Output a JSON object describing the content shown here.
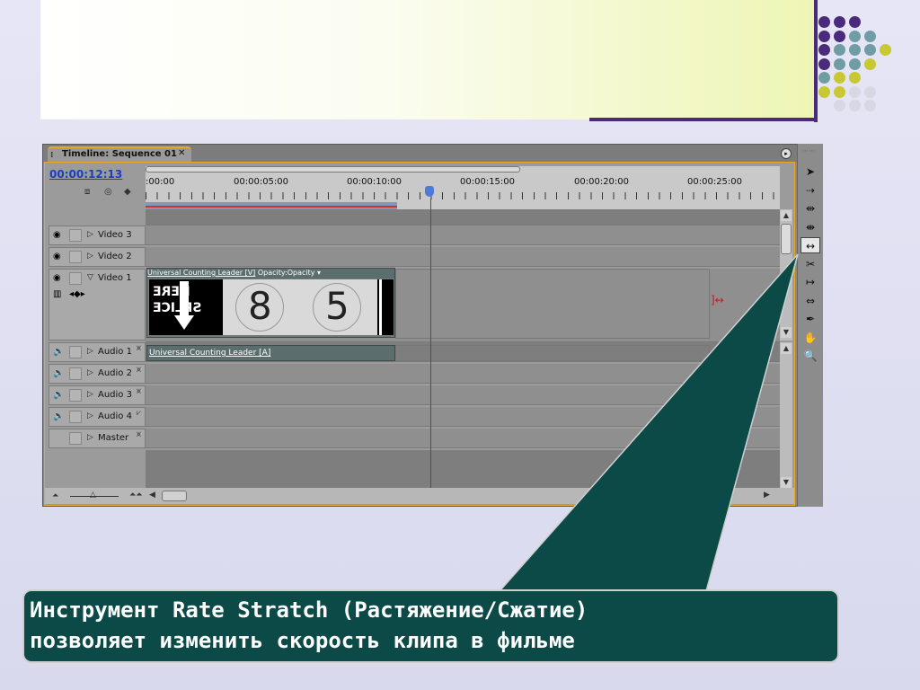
{
  "timeline": {
    "tab_title": "Timeline: Sequence 01",
    "tab_close": "✕",
    "menu_icon": "▸",
    "timecode": "00:00:12:13",
    "ruler_labels": [
      ":00:00",
      "00:00:05:00",
      "00:00:10:00",
      "00:00:15:00",
      "00:00:20:00",
      "00:00:25:00"
    ],
    "tracks": [
      {
        "name": "Video 3",
        "kind": "video",
        "expanded": false
      },
      {
        "name": "Video 2",
        "kind": "video",
        "expanded": false
      },
      {
        "name": "Video 1",
        "kind": "video",
        "expanded": true
      },
      {
        "name": "Audio 1",
        "kind": "audio",
        "expanded": false
      },
      {
        "name": "Audio 2",
        "kind": "audio",
        "expanded": false
      },
      {
        "name": "Audio 3",
        "kind": "audio",
        "expanded": false
      },
      {
        "name": "Audio 4",
        "kind": "audio",
        "expanded": false
      },
      {
        "name": "Master",
        "kind": "master",
        "expanded": false
      }
    ],
    "video_clip": {
      "name": "Universal Counting Leader [V]",
      "effect": "Opacity:Opacity",
      "frame_text_top": "HERE",
      "frame_text_bottom": "SPLICE",
      "frame_digit_1": "8",
      "frame_digit_2": "5"
    },
    "audio_clip": {
      "name": "Universal Counting Leader [A]"
    }
  },
  "tools": [
    {
      "name": "selection-tool",
      "glyph": "➤",
      "active": false
    },
    {
      "name": "track-select-tool",
      "glyph": "⇢",
      "active": false
    },
    {
      "name": "ripple-edit-tool",
      "glyph": "⇹",
      "active": false
    },
    {
      "name": "rolling-edit-tool",
      "glyph": "⇼",
      "active": false
    },
    {
      "name": "rate-stretch-tool",
      "glyph": "↔",
      "active": true
    },
    {
      "name": "razor-tool",
      "glyph": "✂",
      "active": false
    },
    {
      "name": "slip-tool",
      "glyph": "↦",
      "active": false
    },
    {
      "name": "slide-tool",
      "glyph": "⇔",
      "active": false
    },
    {
      "name": "pen-tool",
      "glyph": "✒",
      "active": false
    },
    {
      "name": "hand-tool",
      "glyph": "✋",
      "active": false
    },
    {
      "name": "zoom-tool",
      "glyph": "🔍",
      "active": false
    }
  ],
  "callout": {
    "line1": "Инструмент Rate Stratch (Растяжение/Сжатие)",
    "line2": "позволяет изменить скорость клипа в фильме"
  },
  "colors": {
    "callout_bg": "#0c4a47",
    "accent_purple": "#4a2a7a",
    "dot_purple": "#4a2a7a",
    "dot_teal": "#6e9ea3",
    "dot_yellow": "#c8c832",
    "dot_grey": "#d8d8e4"
  }
}
